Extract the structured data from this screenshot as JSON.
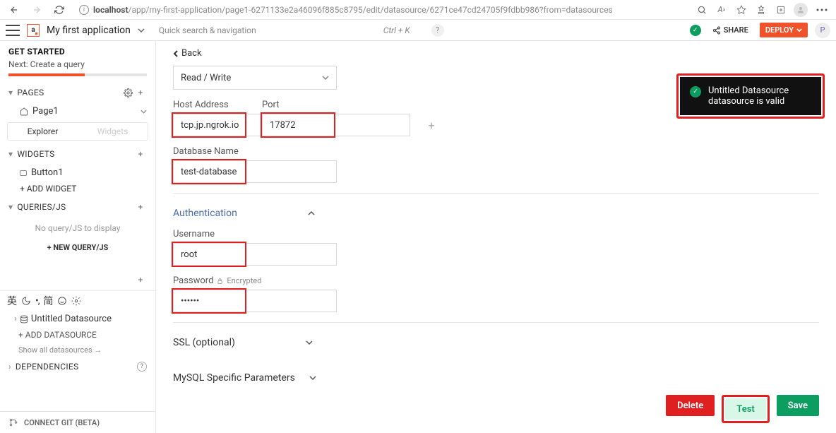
{
  "browser": {
    "url_host": "localhost",
    "url_path": "/app/my-first-application/page1-6271133e2a46096f885c8795/edit/datasource/6271ce47cd24705f9fdbb986?from=datasources"
  },
  "header": {
    "app_name": "My first application",
    "search_placeholder": "Quick search & navigation",
    "search_shortcut": "Ctrl + K",
    "share_label": "SHARE",
    "deploy_label": "DEPLOY",
    "user_initial": "P"
  },
  "sidebar": {
    "get_started_title": "GET STARTED",
    "next_label": "Next: Create a query",
    "pages_label": "PAGES",
    "page_item": "Page1",
    "tab_explorer": "Explorer",
    "tab_widgets": "Widgets",
    "widgets_label": "WIDGETS",
    "widget_item": "Button1",
    "add_widget": "+  ADD WIDGET",
    "queries_label": "QUERIES/JS",
    "queries_empty": "No query/JS to display",
    "new_query": "+  NEW QUERY/JS",
    "ime_chars": [
      "英",
      "简"
    ],
    "ds_item": "Untitled Datasource",
    "add_ds": "+  ADD DATASOURCE",
    "show_all": "Show all datasources   →",
    "deps_label": "DEPENDENCIES",
    "footer": "CONNECT GIT (BETA)"
  },
  "content": {
    "back": "Back",
    "mode_value": "Read / Write",
    "host_label": "Host Address",
    "host_value": "tcp.jp.ngrok.io",
    "port_label": "Port",
    "port_value": "17872",
    "db_label": "Database Name",
    "db_value": "test-database",
    "auth_header": "Authentication",
    "user_label": "Username",
    "user_value": "root",
    "pass_label": "Password",
    "encrypted_label": "Encrypted",
    "pass_value": "••••••",
    "ssl_header": "SSL (optional)",
    "mysql_header": "MySQL Specific Parameters",
    "delete_btn": "Delete",
    "test_btn": "Test",
    "save_btn": "Save"
  },
  "toast": {
    "message": "Untitled Datasource datasource is valid"
  }
}
